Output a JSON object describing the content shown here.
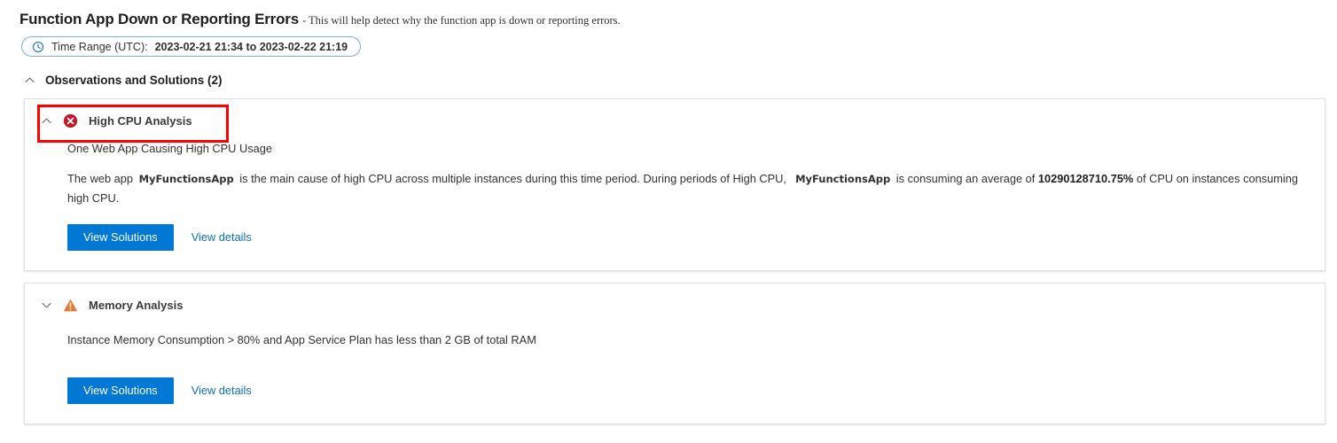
{
  "header": {
    "title": "Function App Down or Reporting Errors",
    "subtitle": "- This will help detect why the function app is down or reporting errors."
  },
  "time_range": {
    "icon": "clock-icon",
    "label": "Time Range (UTC):",
    "value": "2023-02-21 21:34 to 2023-02-22 21:19",
    "border_color": "#7aaee0"
  },
  "section": {
    "chevron": "chevron-up-icon",
    "title": "Observations and Solutions (2)"
  },
  "annotation": {
    "color": "#ff0000"
  },
  "cards": [
    {
      "chevron": "chevron-up-icon",
      "status_icon": "error-circle-x-icon",
      "status_color": "#c2192a",
      "title": "High CPU Analysis",
      "summary": "One Web App Causing High CPU Usage",
      "detail": {
        "part1": "The web app",
        "app_name_1": "MyFunctionsApp",
        "part2": "is the main cause of high CPU across multiple instances during this time period. During periods of High CPU,",
        "app_name_2": "MyFunctionsApp",
        "part3": "is consuming an average of",
        "percent": "10290128710.75%",
        "part4": "of CPU on instances consuming high CPU."
      },
      "primary_button": "View Solutions",
      "link_button": "View details"
    },
    {
      "chevron": "chevron-down-icon",
      "status_icon": "warning-triangle-icon",
      "status_color": "#e8762c",
      "title": "Memory Analysis",
      "summary": "Instance Memory Consumption > 80% and App Service Plan has less than 2 GB of total RAM",
      "primary_button": "View Solutions",
      "link_button": "View details"
    }
  ],
  "theme": {
    "primary_button_bg": "#0078d4",
    "link_color": "#0f6cbd",
    "card_border": "#e1e1e1"
  }
}
